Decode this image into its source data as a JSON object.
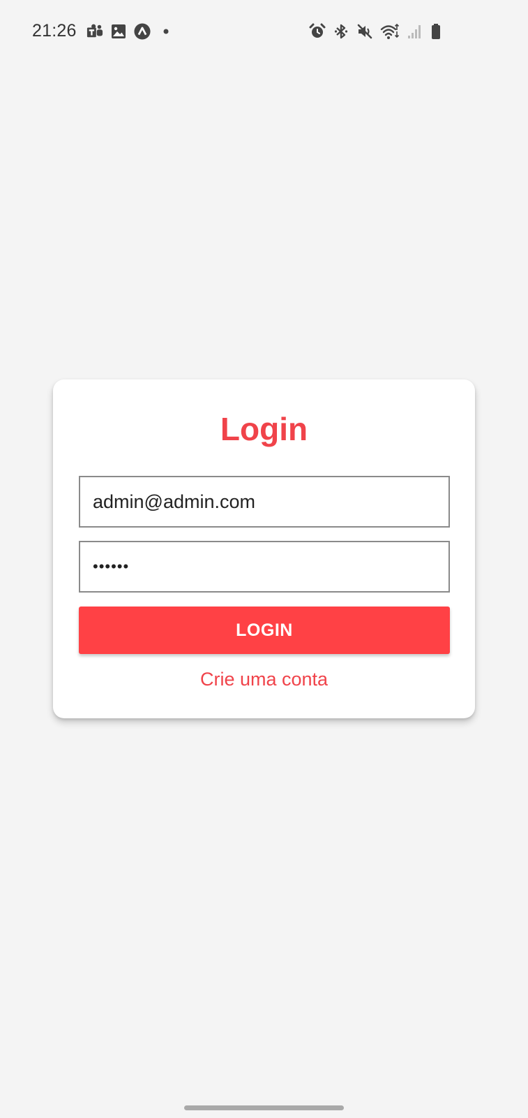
{
  "status_bar": {
    "time": "21:26",
    "left_icons": [
      "teams-icon",
      "gallery-icon",
      "app-a-icon",
      "dot-icon"
    ],
    "right_icons": [
      "alarm-icon",
      "bluetooth-icon",
      "mute-icon",
      "wifi-icon",
      "signal-icon",
      "battery-icon"
    ]
  },
  "login": {
    "title": "Login",
    "email_value": "admin@admin.com",
    "password_value": "••••••",
    "button_label": "LOGIN",
    "signup_link": "Crie uma conta"
  },
  "colors": {
    "accent": "#f0434a",
    "button": "#ff4145",
    "background": "#f4f4f4"
  }
}
